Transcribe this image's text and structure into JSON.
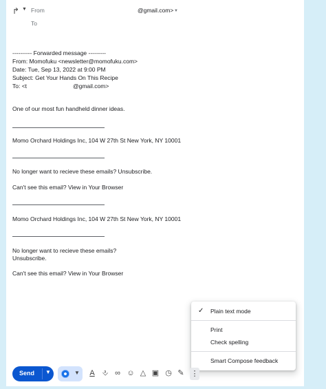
{
  "header": {
    "from_label": "From",
    "from_value": "@gmail.com>",
    "to_label": "To"
  },
  "email": {
    "fwd_line": "---------- Forwarded message ---------",
    "from_line": "From: Momofuku <newsletter@momofuku.com>",
    "date_line": "Date: Tue, Sep 13, 2022 at 9:00 PM",
    "subject_line": "Subject: Get Your Hands On This Recipe",
    "to_prefix": "To: <t",
    "to_suffix": "@gmail.com>",
    "intro": "One of our most fun handheld dinner ideas.",
    "sep": "______________________________",
    "address_1": "Momo Orchard Holdings Inc, 104 W 27th St New York, NY 10001",
    "unsub_1": "No longer want to recieve these emails? Unsubscribe.",
    "browser_1": "Can't see this email? View in Your Browser",
    "address_2": "Momo Orchard Holdings Inc, 104 W 27th St New York, NY 10001",
    "unsub_2a": "No longer want to recieve these emails?",
    "unsub_2b": "Unsubscribe.",
    "browser_2": "Can't see this email? View in Your Browser"
  },
  "menu": {
    "plain_text": "Plain text mode",
    "print": "Print",
    "spelling": "Check spelling",
    "smart_compose": "Smart Compose feedback"
  },
  "toolbar": {
    "send_label": "Send"
  }
}
